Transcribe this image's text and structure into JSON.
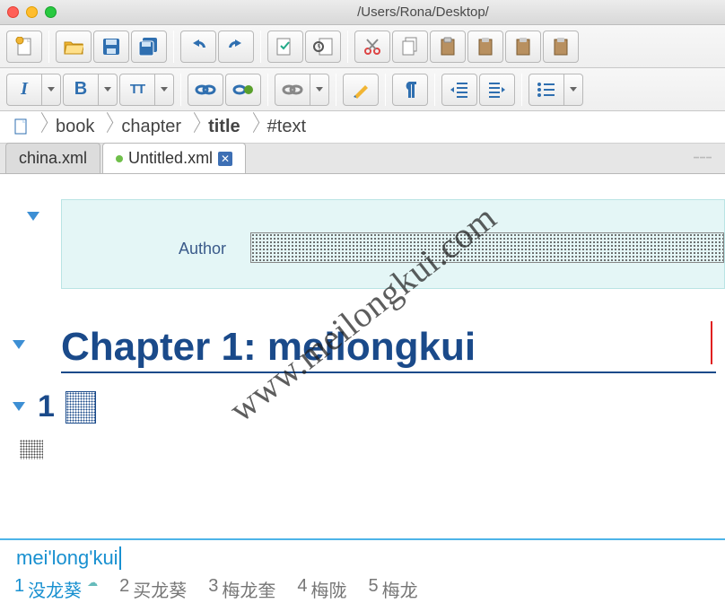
{
  "window": {
    "title": "/Users/Rona/Desktop/"
  },
  "toolbar_row1": {
    "groups": [
      [
        "new-file",
        "open-folder",
        "save",
        "save-all"
      ],
      [
        "undo",
        "redo"
      ],
      [
        "validate",
        "transform"
      ],
      [
        "cut",
        "copy",
        "paste",
        "paste-before",
        "paste-after",
        "paste-content"
      ]
    ]
  },
  "toolbar_row2": {
    "italic_label": "I",
    "bold_label": "B",
    "tt_label": "TT"
  },
  "breadcrumb": {
    "items": [
      {
        "label": "",
        "icon": true
      },
      {
        "label": "book"
      },
      {
        "label": "chapter"
      },
      {
        "label": "title",
        "bold": true
      },
      {
        "label": "#text"
      }
    ]
  },
  "tabs": [
    {
      "label": "china.xml",
      "modified": false,
      "active": false
    },
    {
      "label": "Untitled.xml",
      "modified": true,
      "active": true
    }
  ],
  "editor": {
    "author_label": "Author",
    "chapter_heading": "Chapter 1: meilongkui",
    "section_number": "1"
  },
  "ime": {
    "composition": "mei'long'kui",
    "candidates": [
      {
        "n": "1",
        "text": "没龙葵",
        "cloud": true
      },
      {
        "n": "2",
        "text": "买龙葵"
      },
      {
        "n": "3",
        "text": "梅龙奎"
      },
      {
        "n": "4",
        "text": "梅陇"
      },
      {
        "n": "5",
        "text": "梅龙"
      }
    ]
  },
  "watermark": "www.meilongkui.com"
}
